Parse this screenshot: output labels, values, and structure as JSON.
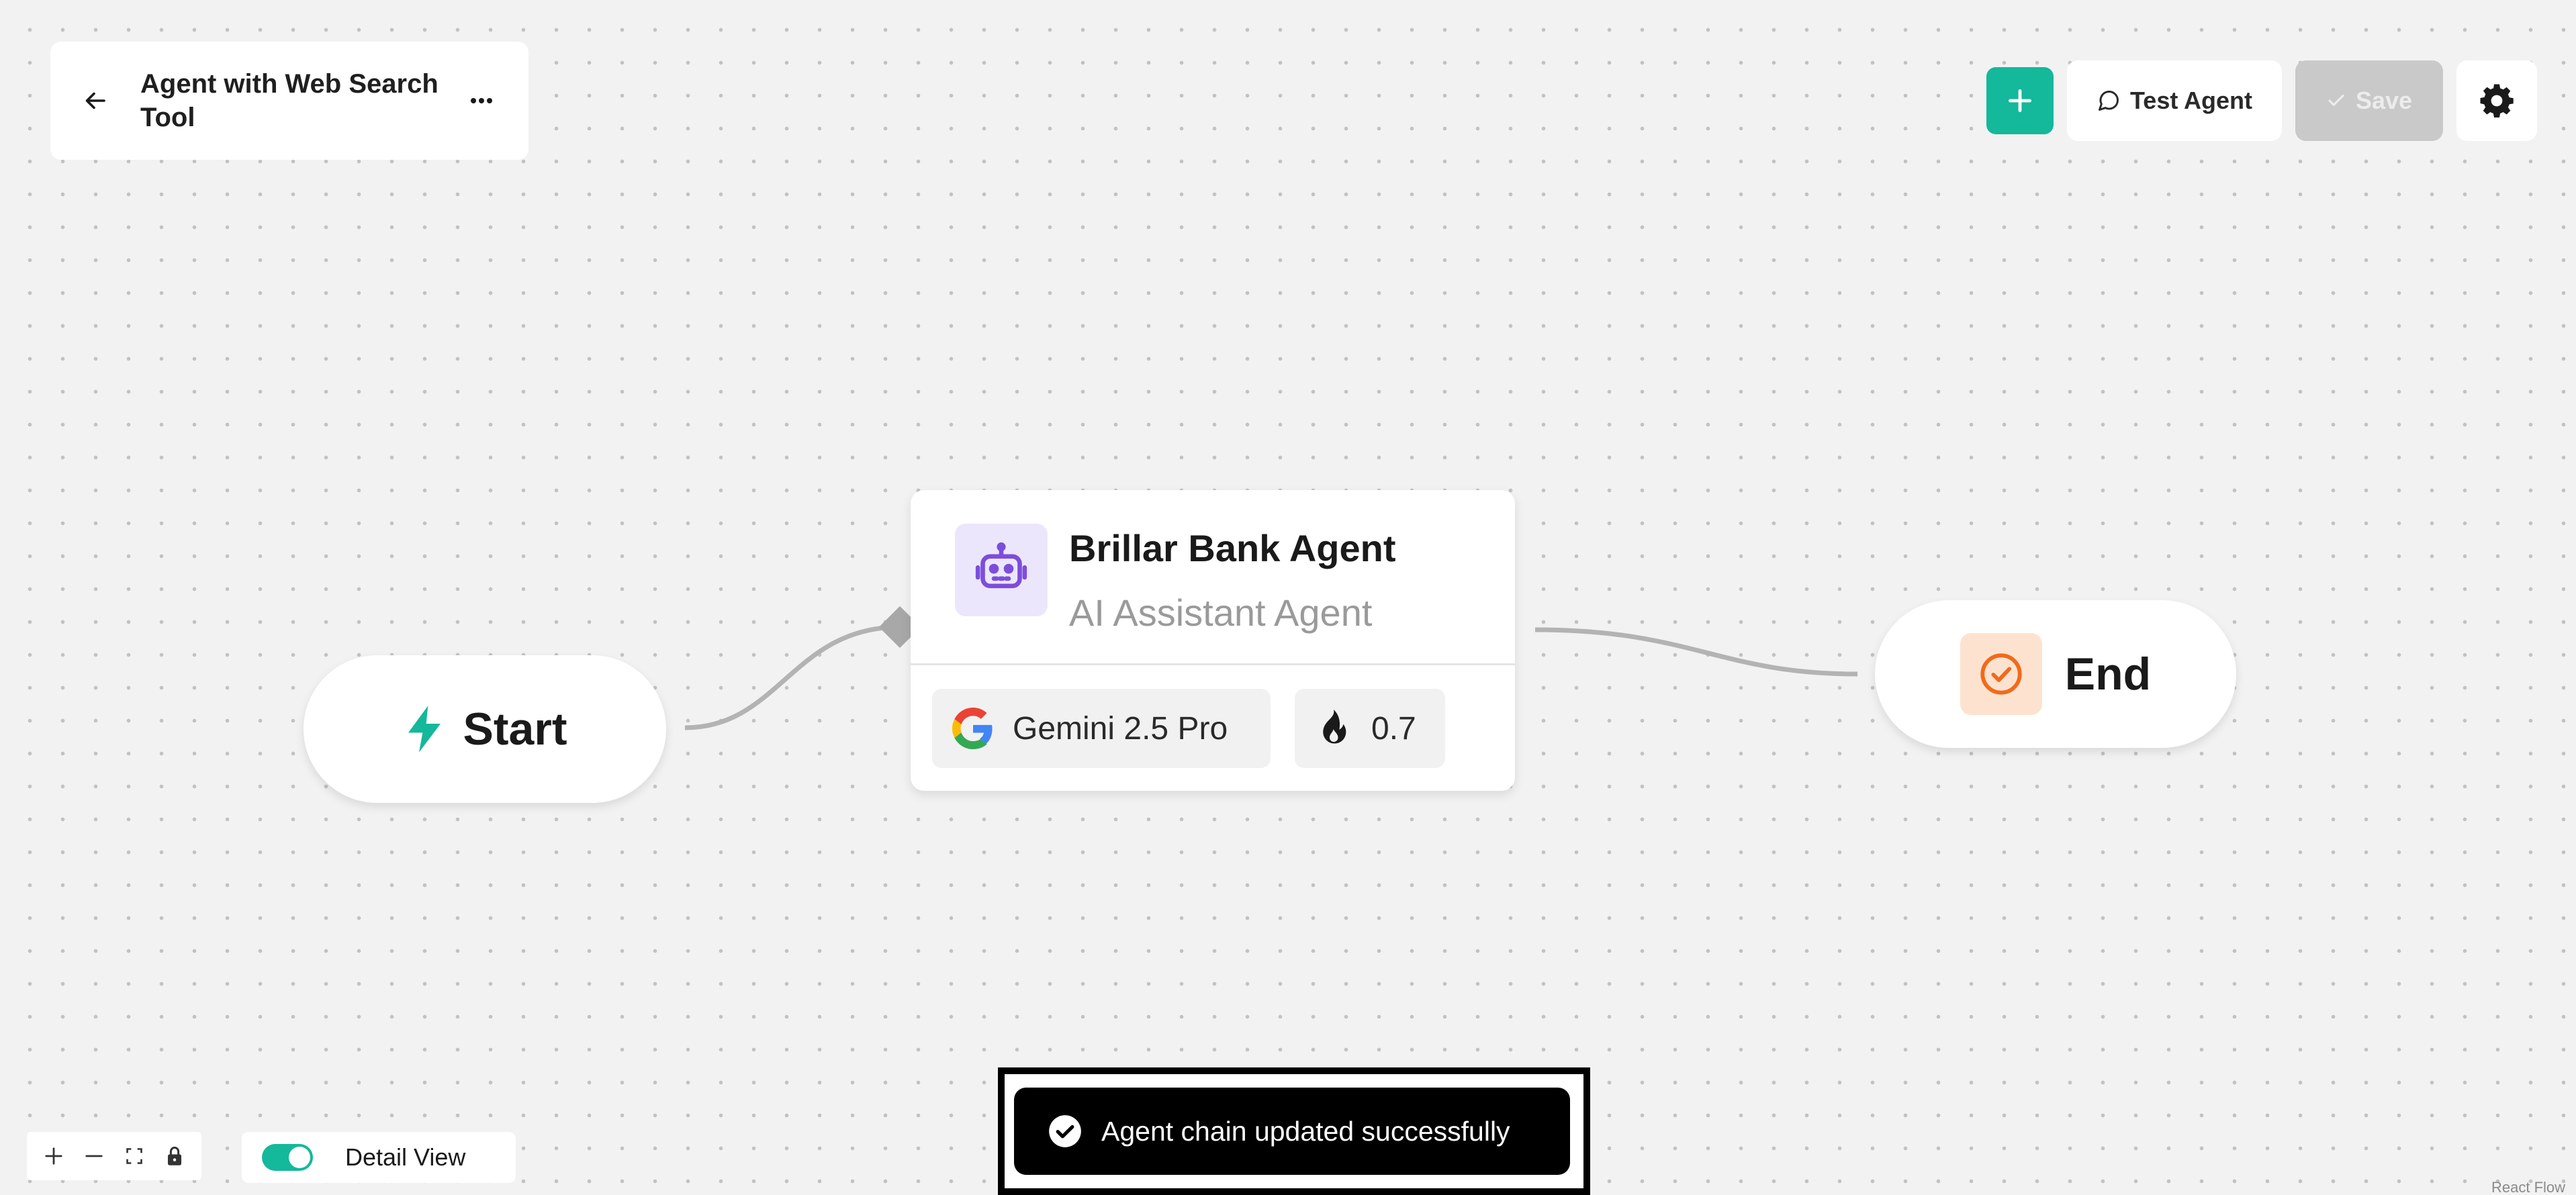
{
  "header": {
    "title": "Agent with Web Search Tool",
    "back_icon": "arrow-left-icon",
    "more_icon": "more-horizontal-icon"
  },
  "toolbar": {
    "add_icon": "plus-icon",
    "test_label": "Test Agent",
    "test_icon": "message-circle-icon",
    "save_label": "Save",
    "save_icon": "check-icon",
    "settings_icon": "gear-icon",
    "accent_color": "#14b89a"
  },
  "nodes": {
    "start": {
      "label": "Start",
      "icon": "lightning-icon",
      "icon_color": "#14b89a"
    },
    "agent": {
      "name": "Brillar Bank Agent",
      "subtitle": "AI Assistant Agent",
      "icon": "robot-icon",
      "icon_color": "#7c4ddb",
      "model": "Gemini 2.5 Pro",
      "model_icon": "google-icon",
      "temperature": "0.7",
      "temperature_icon": "flame-icon"
    },
    "end": {
      "label": "End",
      "icon": "check-circle-icon",
      "icon_color": "#f26a1b"
    }
  },
  "toast": {
    "message": "Agent chain updated successfully",
    "icon": "check-circle-icon"
  },
  "controls": {
    "zoom_in_icon": "plus-icon",
    "zoom_out_icon": "minus-icon",
    "fit_view_icon": "fit-view-icon",
    "lock_icon": "lock-icon",
    "detail_view_label": "Detail View",
    "detail_view_on": true
  },
  "attribution": "React Flow"
}
